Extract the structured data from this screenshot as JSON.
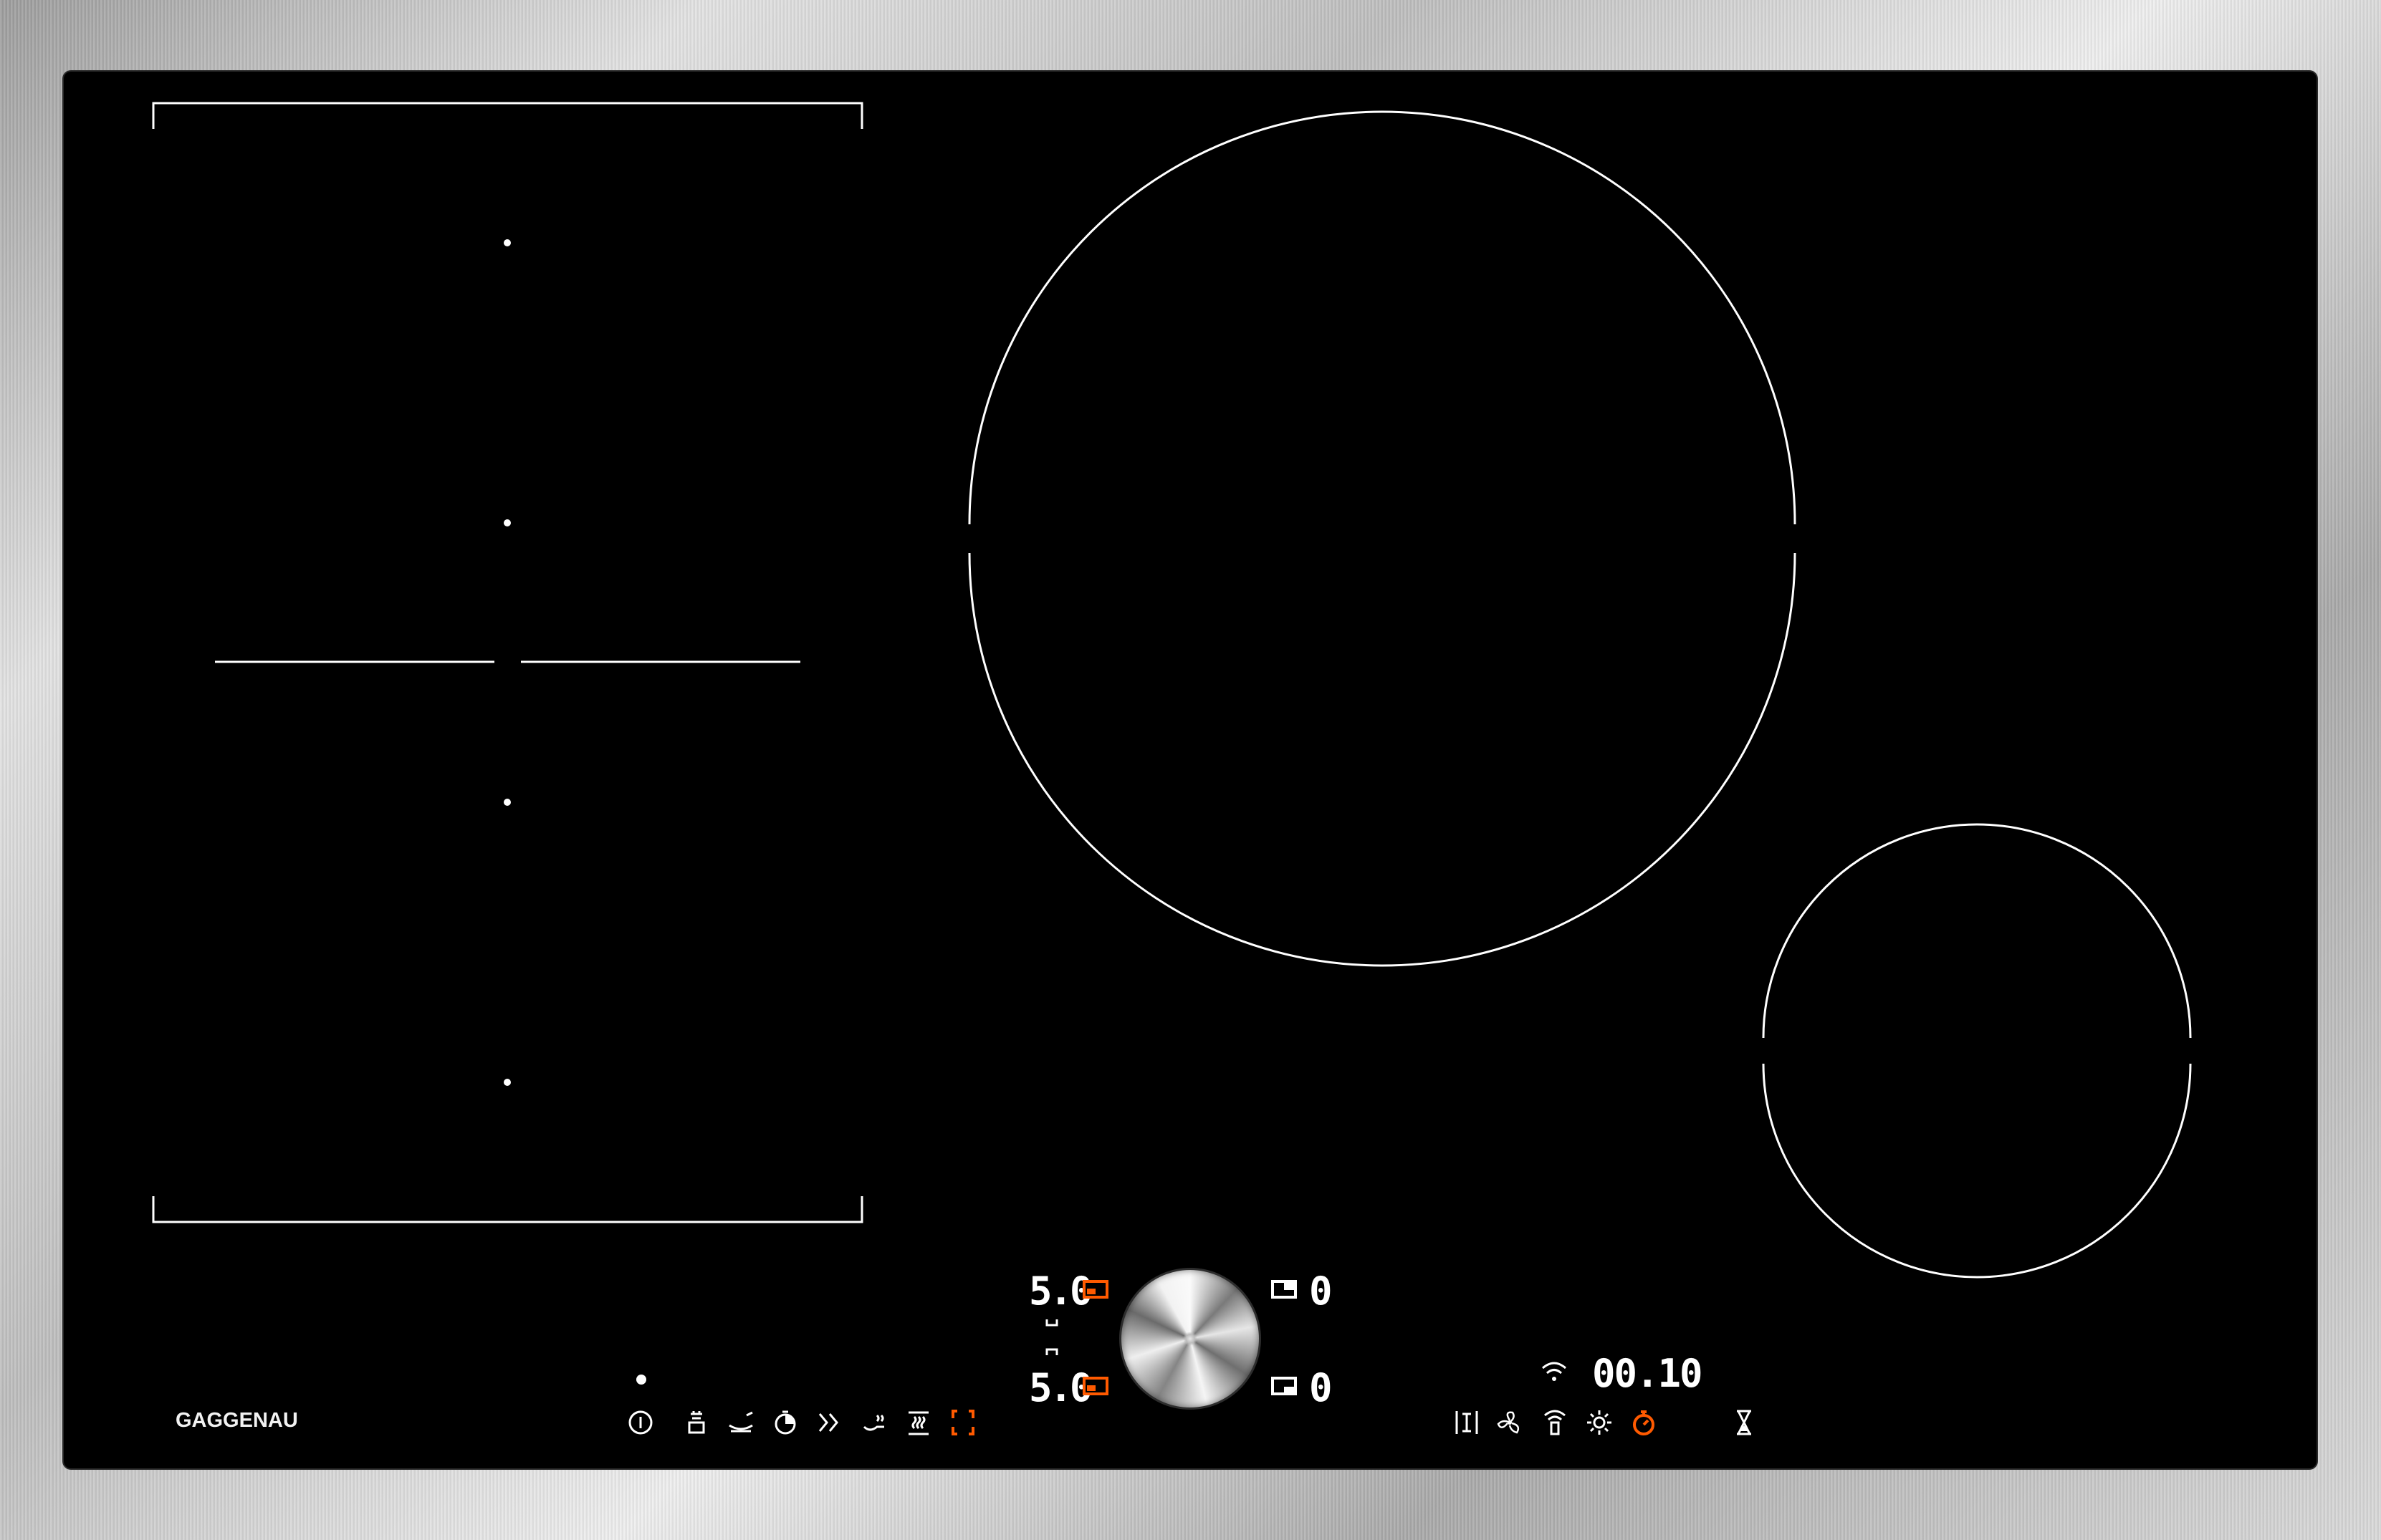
{
  "brand": "GAGGENAU",
  "front_zone_controls": {
    "top_level": "5.0",
    "bottom_level": "5.0"
  },
  "rear_zone_controls": {
    "top_level": "0",
    "bottom_level": "0"
  },
  "timer": {
    "display": "00.10"
  },
  "colors": {
    "glass": "#000000",
    "frame": "stainless steel",
    "accent": "#ff5a00",
    "lines": "#ffffff"
  },
  "left_function_icons": [
    "info-icon",
    "pot-steam-icon",
    "pan-icon",
    "timer-half-icon",
    "boost-icon",
    "keep-warm-icon",
    "heat-icon",
    "flex-zone-icon"
  ],
  "right_function_icons": [
    "stretch-icon",
    "fan-icon",
    "wifi-remote-icon",
    "light-icon",
    "stopwatch-icon",
    "hourglass-icon"
  ]
}
